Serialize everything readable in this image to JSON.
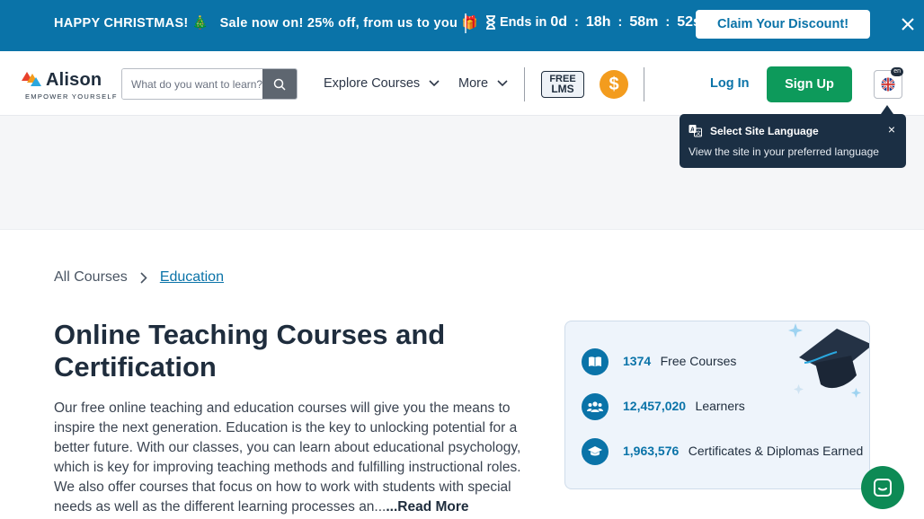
{
  "promo": {
    "message": "HAPPY CHRISTMAS! 🎄",
    "sale": "Sale now on! 25% off, from us to you 🎁",
    "timer_prefix": "Ends in",
    "days": "0d",
    "hours": "18h",
    "minutes": "58m",
    "seconds": "52s",
    "claim_label": "Claim Your Discount!",
    "bg_color": "#0a73a8"
  },
  "header": {
    "logo_name": "Alison",
    "logo_tag": "EMPOWER YOURSELF",
    "search_placeholder": "What do you want to learn?",
    "explore_label": "Explore Courses",
    "more_label": "More",
    "free_lms_line1": "FREE",
    "free_lms_line2": "LMS",
    "coin_symbol": "$",
    "login_label": "Log In",
    "signup_label": "Sign Up",
    "lang_badge": "en",
    "accent_color": "#0d9a5b"
  },
  "lang_popup": {
    "title": "Select Site Language",
    "subtitle": "View the site in your preferred language",
    "close": "×"
  },
  "breadcrumb": {
    "all": "All Courses",
    "current": "Education"
  },
  "main": {
    "title": "Online Teaching Courses and Certification",
    "description": "Our free online teaching and education courses will give you the means to inspire the next generation. Education is the key to unlocking potential for a better future. With our classes, you can learn about educational psychology, which is key for improving teaching methods and fulfilling instructional roles. We also offer courses that focus on how to work with students with special needs as well as the different learning processes an...",
    "read_more": "...Read More"
  },
  "stats": [
    {
      "value": "1374",
      "label": "Free Courses",
      "icon": "book-icon"
    },
    {
      "value": "12,457,020",
      "label": "Learners",
      "icon": "users-icon"
    },
    {
      "value": "1,963,576",
      "label": "Certificates & Diplomas Earned",
      "icon": "graduation-cap-icon"
    }
  ]
}
